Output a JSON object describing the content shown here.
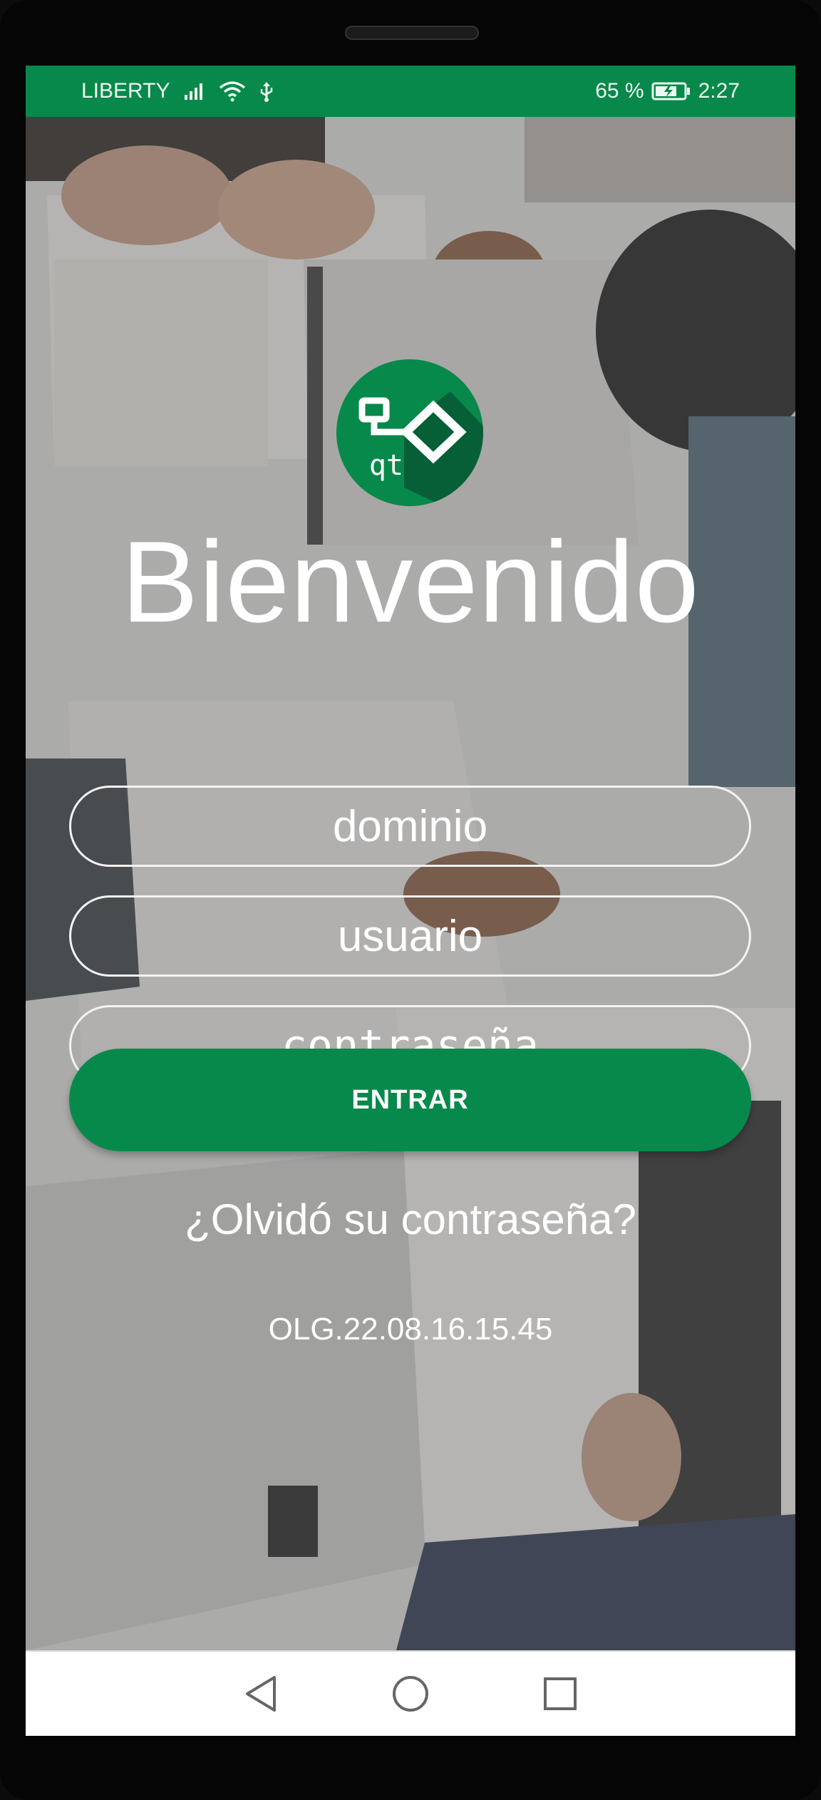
{
  "status_bar": {
    "carrier": "LIBERTY",
    "battery_percent": "65 %",
    "time": "2:27"
  },
  "login": {
    "title": "Bienvenido",
    "logo_text": "qt",
    "domain_placeholder": "dominio",
    "user_placeholder": "usuario",
    "password_placeholder": "contraseña",
    "submit_label": "ENTRAR",
    "forgot_password": "¿Olvidó su contraseña?",
    "version": "OLG.22.08.16.15.45"
  },
  "colors": {
    "brand_green": "#07894b",
    "nav_background": "#ffffff"
  },
  "icons": {
    "status": [
      "signal-icon",
      "wifi-icon",
      "usb-icon",
      "battery-icon"
    ],
    "nav": [
      "back-icon",
      "home-icon",
      "recents-icon"
    ]
  }
}
